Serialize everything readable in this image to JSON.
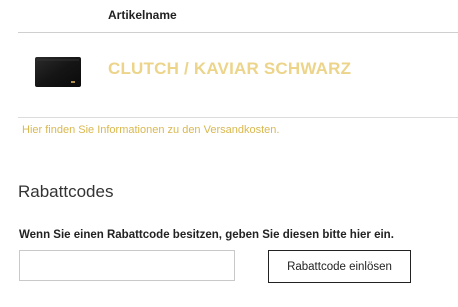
{
  "cart": {
    "column_header": "Artikelname",
    "items": [
      {
        "name": "CLUTCH / KAVIAR SCHWARZ",
        "thumbnail_icon": "black-clutch-image"
      }
    ],
    "shipping_link": "Hier finden Sie Informationen zu den Versandkosten."
  },
  "coupon": {
    "title": "Rabattcodes",
    "hint": "Wenn Sie einen Rabattcode besitzen, geben Sie diesen bitte hier ein.",
    "input_value": "",
    "input_placeholder": "",
    "button_label": "Rabattcode einlösen"
  },
  "colors": {
    "accent": "#ecd48a",
    "link": "#d9b84f",
    "text": "#222222",
    "divider": "#cfcfcf"
  }
}
